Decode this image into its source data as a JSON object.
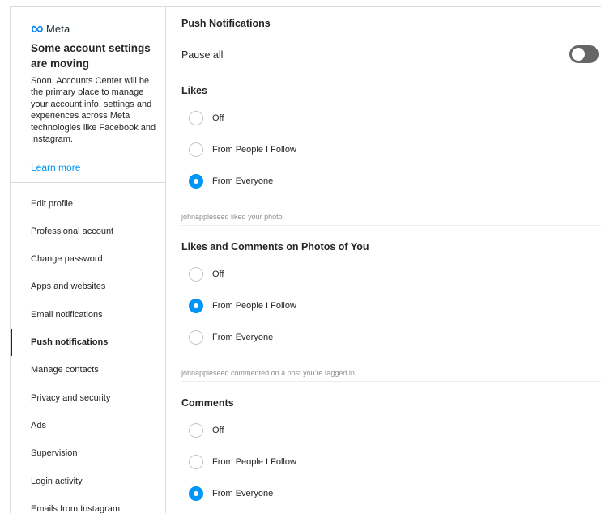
{
  "meta_card": {
    "logo_text": "Meta",
    "title": "Some account settings are moving",
    "description": "Soon, Accounts Center will be the primary place to manage your account info, settings and experiences across Meta technologies like Facebook and Instagram.",
    "learn_more": "Learn more"
  },
  "nav": {
    "items": [
      {
        "label": "Edit profile"
      },
      {
        "label": "Professional account"
      },
      {
        "label": "Change password"
      },
      {
        "label": "Apps and websites"
      },
      {
        "label": "Email notifications"
      },
      {
        "label": "Push notifications",
        "active": true
      },
      {
        "label": "Manage contacts"
      },
      {
        "label": "Privacy and security"
      },
      {
        "label": "Ads"
      },
      {
        "label": "Supervision"
      },
      {
        "label": "Login activity"
      },
      {
        "label": "Emails from Instagram"
      }
    ]
  },
  "push": {
    "title": "Push Notifications",
    "pause_all": {
      "label": "Pause all",
      "on": false
    },
    "sections": [
      {
        "title": "Likes",
        "options": [
          "Off",
          "From People I Follow",
          "From Everyone"
        ],
        "selected_option": "From Everyone",
        "example": "johnappleseed liked your photo."
      },
      {
        "title": "Likes and Comments on Photos of You",
        "options": [
          "Off",
          "From People I Follow",
          "From Everyone"
        ],
        "selected_option": "From People I Follow",
        "example": "johnappleseed commented on a post you're tagged in."
      },
      {
        "title": "Comments",
        "options": [
          "Off",
          "From People I Follow",
          "From Everyone"
        ],
        "selected_option": "From Everyone"
      }
    ]
  },
  "colors": {
    "accent": "#0095f6",
    "toggle_off": "#666666",
    "border": "#dbdbdb",
    "meta_blue": "#0082fb"
  },
  "icons": [
    "meta-logo-icon",
    "radio-icon",
    "toggle-icon"
  ]
}
